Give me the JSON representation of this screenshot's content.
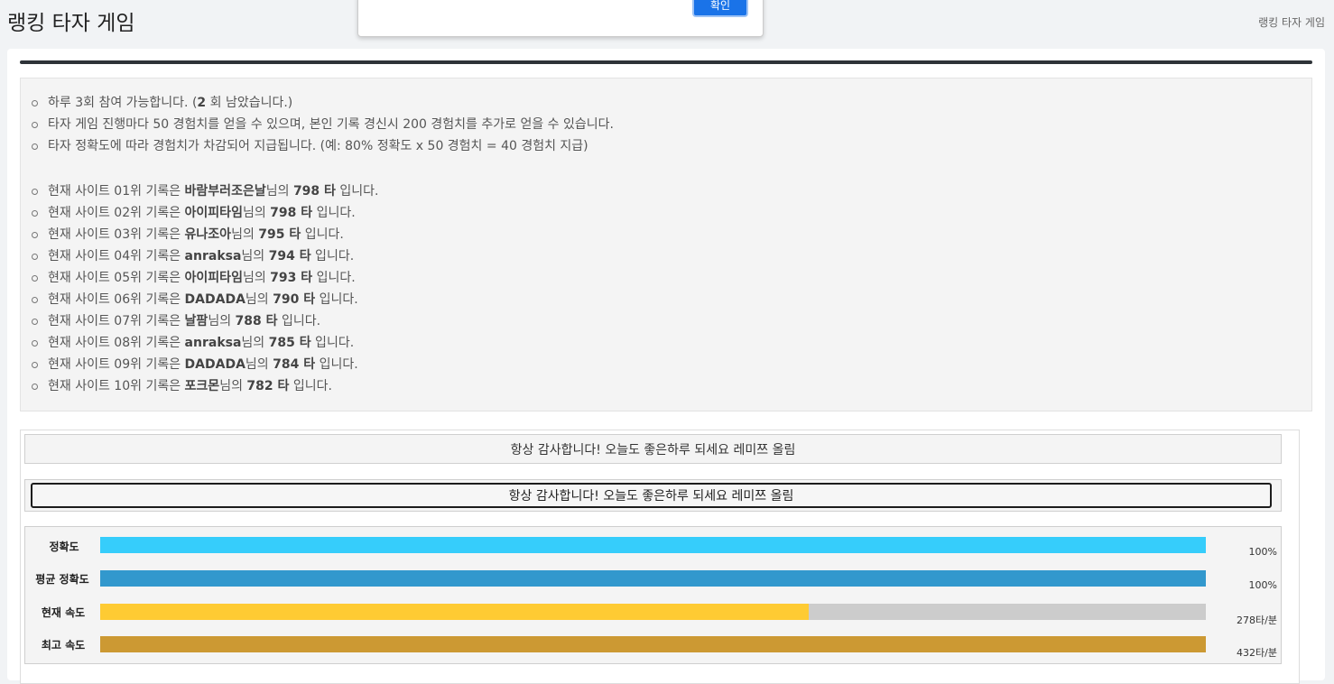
{
  "header": {
    "title": "랭킹 타자 게임",
    "breadcrumb": "랭킹 타자 게임"
  },
  "dialog": {
    "confirm_label": "확인"
  },
  "notices": [
    {
      "pre": "하루 3회 참여 가능합니다. (",
      "bold": "2",
      "post": " 회 남았습니다.)"
    },
    {
      "pre": "타자 게임 진행마다 50 경험치를 얻을 수 있으며, 본인 기록 경신시 200 경험치를 추가로 얻을 수 있습니다.",
      "bold": "",
      "post": ""
    },
    {
      "pre": "타자 정확도에 따라 경험치가 차감되어 지급됩니다. (예: 80% 정확도 x 50 경험치 = 40 경험치 지급)",
      "bold": "",
      "post": ""
    }
  ],
  "rankings": [
    {
      "prefix": "현재 사이트 01위 기록은 ",
      "name": "바람부러조은날",
      "mid": "님의 ",
      "score": "798 타",
      "suffix": " 입니다."
    },
    {
      "prefix": "현재 사이트 02위 기록은 ",
      "name": "아이피타임",
      "mid": "님의 ",
      "score": "798 타",
      "suffix": " 입니다."
    },
    {
      "prefix": "현재 사이트 03위 기록은 ",
      "name": "유나조아",
      "mid": "님의 ",
      "score": "795 타",
      "suffix": " 입니다."
    },
    {
      "prefix": "현재 사이트 04위 기록은 ",
      "name": "anraksa",
      "mid": "님의 ",
      "score": "794 타",
      "suffix": " 입니다."
    },
    {
      "prefix": "현재 사이트 05위 기록은 ",
      "name": "아이피타임",
      "mid": "님의 ",
      "score": "793 타",
      "suffix": " 입니다."
    },
    {
      "prefix": "현재 사이트 06위 기록은 ",
      "name": "DADADA",
      "mid": "님의 ",
      "score": "790 타",
      "suffix": " 입니다."
    },
    {
      "prefix": "현재 사이트 07위 기록은 ",
      "name": "날팜",
      "mid": "님의 ",
      "score": "788 타",
      "suffix": " 입니다."
    },
    {
      "prefix": "현재 사이트 08위 기록은 ",
      "name": "anraksa",
      "mid": "님의 ",
      "score": "785 타",
      "suffix": " 입니다."
    },
    {
      "prefix": "현재 사이트 09위 기록은 ",
      "name": "DADADA",
      "mid": "님의 ",
      "score": "784 타",
      "suffix": " 입니다."
    },
    {
      "prefix": "현재 사이트 10위 기록은 ",
      "name": "포크몬",
      "mid": "님의 ",
      "score": "782 타",
      "suffix": " 입니다."
    }
  ],
  "game": {
    "target_text": "항상 감사합니다! 오늘도 좋은하루 되세요 레미쯔 올림",
    "input_value": "항상 감사합니다! 오늘도 좋은하루 되세요 레미쯔 올림"
  },
  "stats": [
    {
      "label": "정확도",
      "value": "100%",
      "fill": 1.0,
      "color": "#36cdfb"
    },
    {
      "label": "평균 정확도",
      "value": "100%",
      "fill": 1.0,
      "color": "#3298cd"
    },
    {
      "label": "현재 속도",
      "value": "278타/분",
      "fill": 0.641,
      "color": "#fecb33"
    },
    {
      "label": "최고 속도",
      "value": "432타/분",
      "fill": 1.0,
      "color": "#cc9933"
    }
  ],
  "colors": {
    "background": "#f1f3f5",
    "accent": "#1a73e8",
    "rule": "#2e3338"
  }
}
